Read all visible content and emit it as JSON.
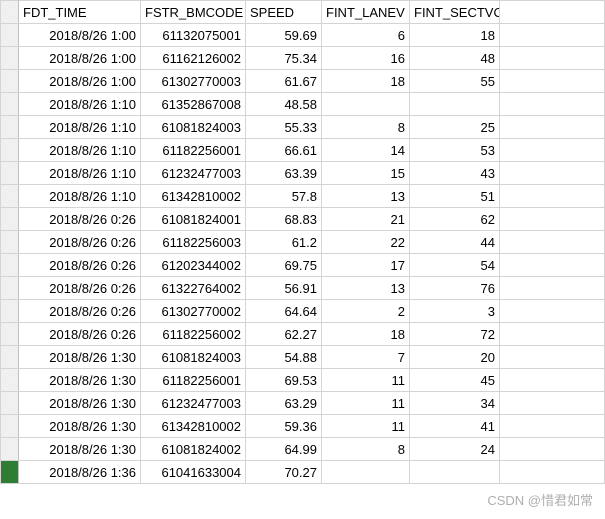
{
  "headers": {
    "time": "FDT_TIME",
    "bmcode": "FSTR_BMCODE",
    "speed": "SPEED",
    "lane": "FINT_LANEV",
    "sect": "FINT_SECTVOLUME"
  },
  "rows": [
    {
      "time": "2018/8/26 1:00",
      "bmcode": "61132075001",
      "speed": "59.69",
      "lane": "6",
      "sect": "18"
    },
    {
      "time": "2018/8/26 1:00",
      "bmcode": "61162126002",
      "speed": "75.34",
      "lane": "16",
      "sect": "48"
    },
    {
      "time": "2018/8/26 1:00",
      "bmcode": "61302770003",
      "speed": "61.67",
      "lane": "18",
      "sect": "55"
    },
    {
      "time": "2018/8/26 1:10",
      "bmcode": "61352867008",
      "speed": "48.58",
      "lane": "",
      "sect": ""
    },
    {
      "time": "2018/8/26 1:10",
      "bmcode": "61081824003",
      "speed": "55.33",
      "lane": "8",
      "sect": "25"
    },
    {
      "time": "2018/8/26 1:10",
      "bmcode": "61182256001",
      "speed": "66.61",
      "lane": "14",
      "sect": "53"
    },
    {
      "time": "2018/8/26 1:10",
      "bmcode": "61232477003",
      "speed": "63.39",
      "lane": "15",
      "sect": "43"
    },
    {
      "time": "2018/8/26 1:10",
      "bmcode": "61342810002",
      "speed": "57.8",
      "lane": "13",
      "sect": "51"
    },
    {
      "time": "2018/8/26 0:26",
      "bmcode": "61081824001",
      "speed": "68.83",
      "lane": "21",
      "sect": "62"
    },
    {
      "time": "2018/8/26 0:26",
      "bmcode": "61182256003",
      "speed": "61.2",
      "lane": "22",
      "sect": "44"
    },
    {
      "time": "2018/8/26 0:26",
      "bmcode": "61202344002",
      "speed": "69.75",
      "lane": "17",
      "sect": "54"
    },
    {
      "time": "2018/8/26 0:26",
      "bmcode": "61322764002",
      "speed": "56.91",
      "lane": "13",
      "sect": "76"
    },
    {
      "time": "2018/8/26 0:26",
      "bmcode": "61302770002",
      "speed": "64.64",
      "lane": "2",
      "sect": "3"
    },
    {
      "time": "2018/8/26 0:26",
      "bmcode": "61182256002",
      "speed": "62.27",
      "lane": "18",
      "sect": "72"
    },
    {
      "time": "2018/8/26 1:30",
      "bmcode": "61081824003",
      "speed": "54.88",
      "lane": "7",
      "sect": "20"
    },
    {
      "time": "2018/8/26 1:30",
      "bmcode": "61182256001",
      "speed": "69.53",
      "lane": "11",
      "sect": "45"
    },
    {
      "time": "2018/8/26 1:30",
      "bmcode": "61232477003",
      "speed": "63.29",
      "lane": "11",
      "sect": "34"
    },
    {
      "time": "2018/8/26 1:30",
      "bmcode": "61342810002",
      "speed": "59.36",
      "lane": "11",
      "sect": "41"
    },
    {
      "time": "2018/8/26 1:30",
      "bmcode": "61081824002",
      "speed": "64.99",
      "lane": "8",
      "sect": "24"
    },
    {
      "time": "2018/8/26 1:36",
      "bmcode": "61041633004",
      "speed": "70.27",
      "lane": "",
      "sect": ""
    }
  ],
  "watermark": "CSDN @惜君如常"
}
